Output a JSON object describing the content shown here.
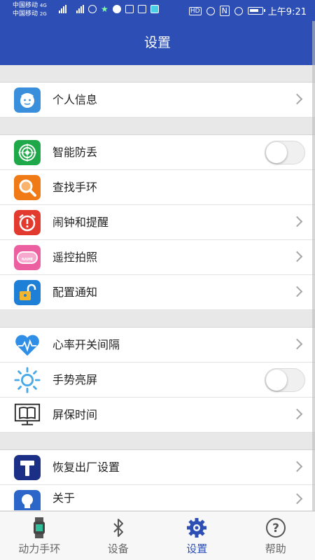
{
  "status_bar": {
    "carrier_1": "中国移动",
    "carrier_2": "中国移动",
    "net_1": "4G",
    "net_2": "2G",
    "hd": "HD",
    "nfc": "N",
    "time": "上午9:21"
  },
  "header": {
    "title": "设置"
  },
  "groups": [
    {
      "items": [
        {
          "label": "个人信息",
          "icon": "user-face-icon",
          "color": "#3a8fdd",
          "accessory": "chevron"
        }
      ]
    },
    {
      "items": [
        {
          "label": "智能防丢",
          "icon": "radar-icon",
          "color": "#1fa84a",
          "accessory": "toggle",
          "toggle_on": false
        },
        {
          "label": "查找手环",
          "icon": "magnifier-icon",
          "color": "#f07a16",
          "accessory": "none"
        },
        {
          "label": "闹钟和提醒",
          "icon": "alarm-clock-icon",
          "color": "#e33a2f",
          "accessory": "chevron"
        },
        {
          "label": "遥控拍照",
          "icon": "name-badge-icon",
          "color": "#ec5fa0",
          "accessory": "chevron",
          "badge": "NAME"
        },
        {
          "label": "配置通知",
          "icon": "unlock-icon",
          "color": "#1e7fd6",
          "accessory": "chevron"
        }
      ]
    },
    {
      "items": [
        {
          "label": "心率开关间隔",
          "icon": "heart-rate-icon",
          "color": "#2f8fe6",
          "accessory": "chevron"
        },
        {
          "label": "手势亮屏",
          "icon": "sun-icon",
          "color": "#47a9e8",
          "accessory": "toggle",
          "toggle_on": false
        },
        {
          "label": "屏保时间",
          "icon": "book-monitor-icon",
          "color": "#222222",
          "accessory": "chevron"
        }
      ]
    },
    {
      "items": [
        {
          "label": "恢复出厂设置",
          "icon": "hammer-icon",
          "color": "#1c2f86",
          "accessory": "chevron"
        },
        {
          "label": "关于",
          "icon": "lightbulb-icon",
          "color": "#2c66c9",
          "accessory": "chevron"
        }
      ]
    }
  ],
  "tabs": [
    {
      "label": "动力手环",
      "icon": "band-icon",
      "active": false
    },
    {
      "label": "设备",
      "icon": "bluetooth-icon",
      "active": false
    },
    {
      "label": "设置",
      "icon": "gear-icon",
      "active": true
    },
    {
      "label": "帮助",
      "icon": "help-icon",
      "active": false
    }
  ],
  "colors": {
    "primary": "#2d4fb5",
    "background": "#e8e8e8",
    "chevron": "#a6a6a6"
  }
}
